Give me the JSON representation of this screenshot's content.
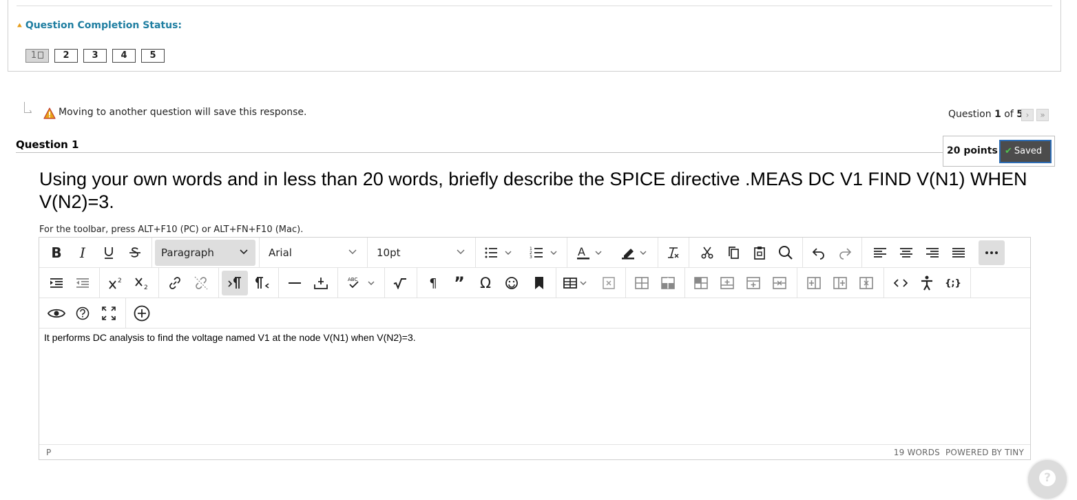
{
  "completion": {
    "label": "Question Completion Status:",
    "questions": [
      "1",
      "2",
      "3",
      "4",
      "5"
    ],
    "current": 0
  },
  "warning": {
    "text": "Moving to another question will save this response."
  },
  "pager": {
    "prefix": "Question ",
    "current": "1",
    "of": " of ",
    "total": "5"
  },
  "question": {
    "title": "Question 1",
    "points": "20 points",
    "saved_label": "Saved",
    "text": "Using your own words and in less than 20 words, briefly describe the SPICE directive .MEAS DC V1 FIND V(N1) WHEN V(N2)=3."
  },
  "editor": {
    "hint": "For the toolbar, press ALT+F10 (PC) or ALT+FN+F10 (Mac).",
    "block_format": "Paragraph",
    "font_family": "Arial",
    "font_size": "10pt",
    "content": "It performs DC analysis to find the voltage named V1 at the node V(N1) when V(N2)=3.",
    "path": "P",
    "word_count": "19 WORDS",
    "powered_by": "POWERED BY TINY"
  },
  "colors": {
    "accent": "#1f7ea1",
    "saved_bg": "#4c4c4c",
    "saved_border": "#2d6cb3",
    "warning": "#e8a317"
  }
}
